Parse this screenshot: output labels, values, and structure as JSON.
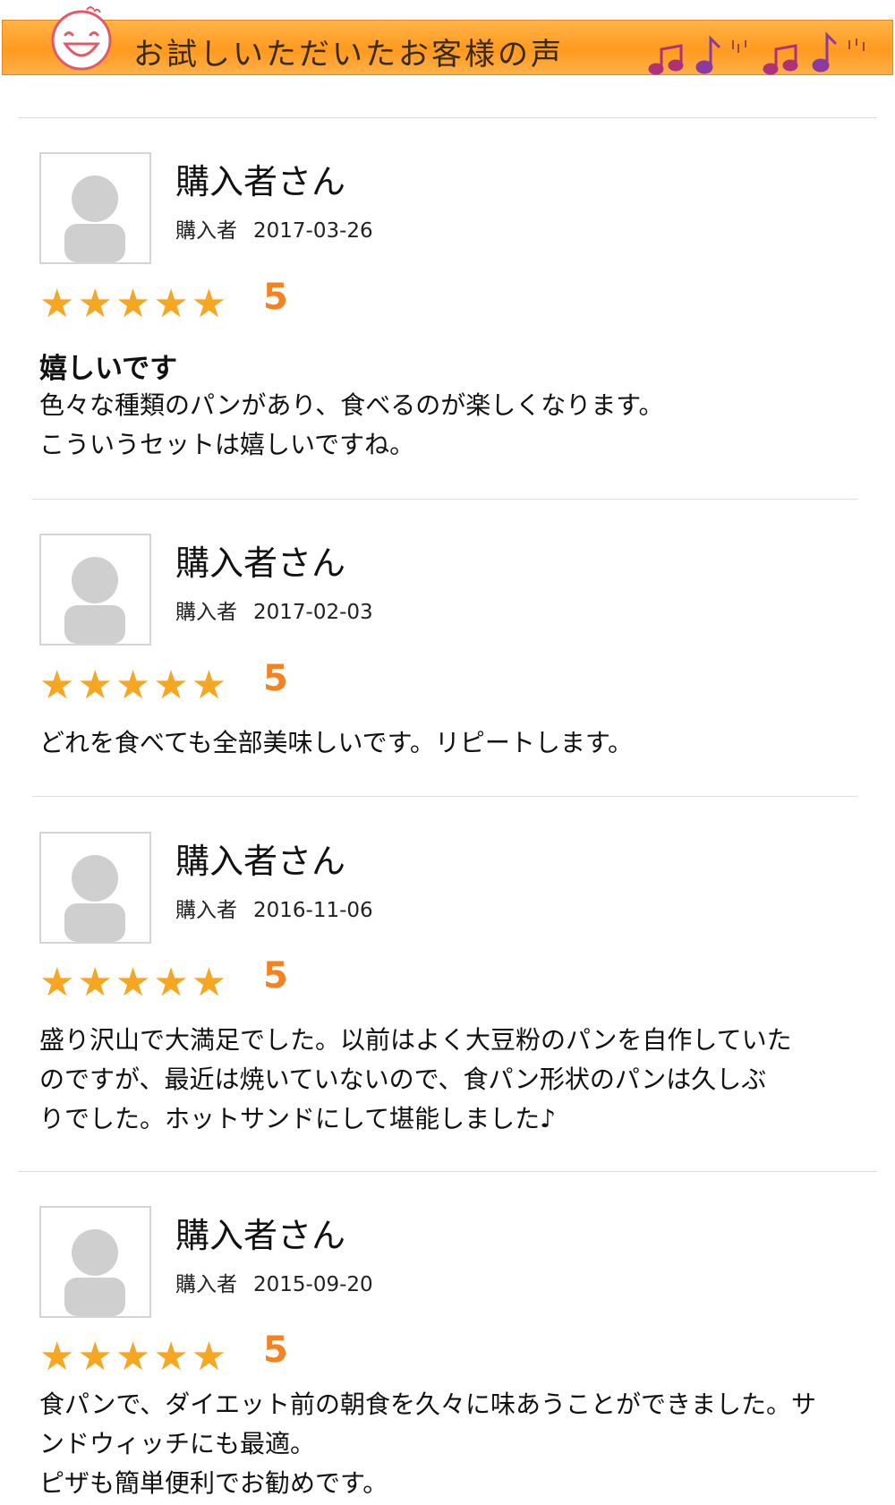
{
  "banner": {
    "title": "お試しいただいたお客様の声",
    "icons": [
      "smiley-face-icon",
      "music-notes-icon"
    ]
  },
  "reviews": [
    {
      "name": "購入者さん",
      "role": "購入者",
      "date": "2017-03-26",
      "stars": "★★★★★",
      "rating": "5",
      "title": "嬉しいです",
      "body": [
        "色々な種類のパンがあり、食べるのが楽しくなります。",
        "こういうセットは嬉しいですね。"
      ]
    },
    {
      "name": "購入者さん",
      "role": "購入者",
      "date": "2017-02-03",
      "stars": "★★★★★",
      "rating": "5",
      "title": "",
      "body": [
        "どれを食べても全部美味しいです。リピートします。"
      ]
    },
    {
      "name": "購入者さん",
      "role": "購入者",
      "date": "2016-11-06",
      "stars": "★★★★★",
      "rating": "5",
      "title": "",
      "body": [
        "盛り沢山で大満足でした。以前はよく大豆粉のパンを自作していた",
        "のですが、最近は焼いていないので、食パン形状のパンは久しぶ",
        "りでした。ホットサンドにして堪能しました♪"
      ]
    },
    {
      "name": "購入者さん",
      "role": "購入者",
      "date": "2015-09-20",
      "stars": "★★★★★",
      "rating": "5",
      "title": "",
      "body": [
        "食パンで、ダイエット前の朝食を久々に味あうことができました。サ",
        "ンドウィッチにも最適。",
        "ピザも簡単便利でお勧めです。"
      ]
    }
  ]
}
